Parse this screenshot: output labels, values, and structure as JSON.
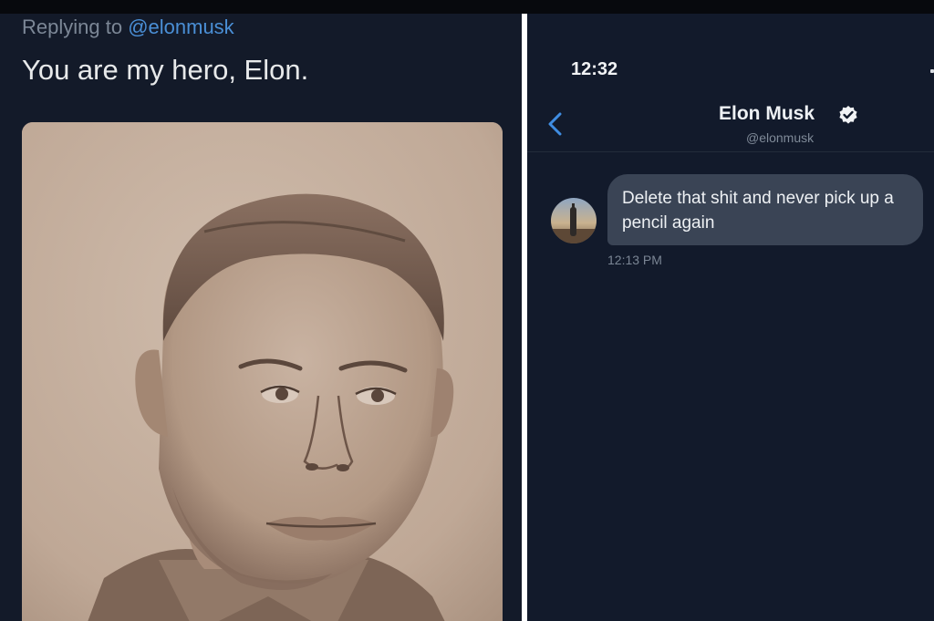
{
  "left_panel": {
    "replying_prefix": "Replying to ",
    "replying_handle": "@elonmusk",
    "tweet_text": "You are my hero, Elon."
  },
  "right_panel": {
    "status_time": "12:32",
    "header": {
      "name": "Elon Musk",
      "handle": "@elonmusk"
    },
    "message": {
      "text": "Delete that shit and never pick up a pencil again",
      "time": "12:13 PM"
    }
  },
  "icons": {
    "back": "chevron-left-icon",
    "verified": "verified-badge-icon"
  },
  "colors": {
    "background": "#121a2b",
    "link_blue": "#4a8fd6",
    "bubble": "#3a4455",
    "text": "#e7e9ea",
    "muted": "#7c8796"
  }
}
